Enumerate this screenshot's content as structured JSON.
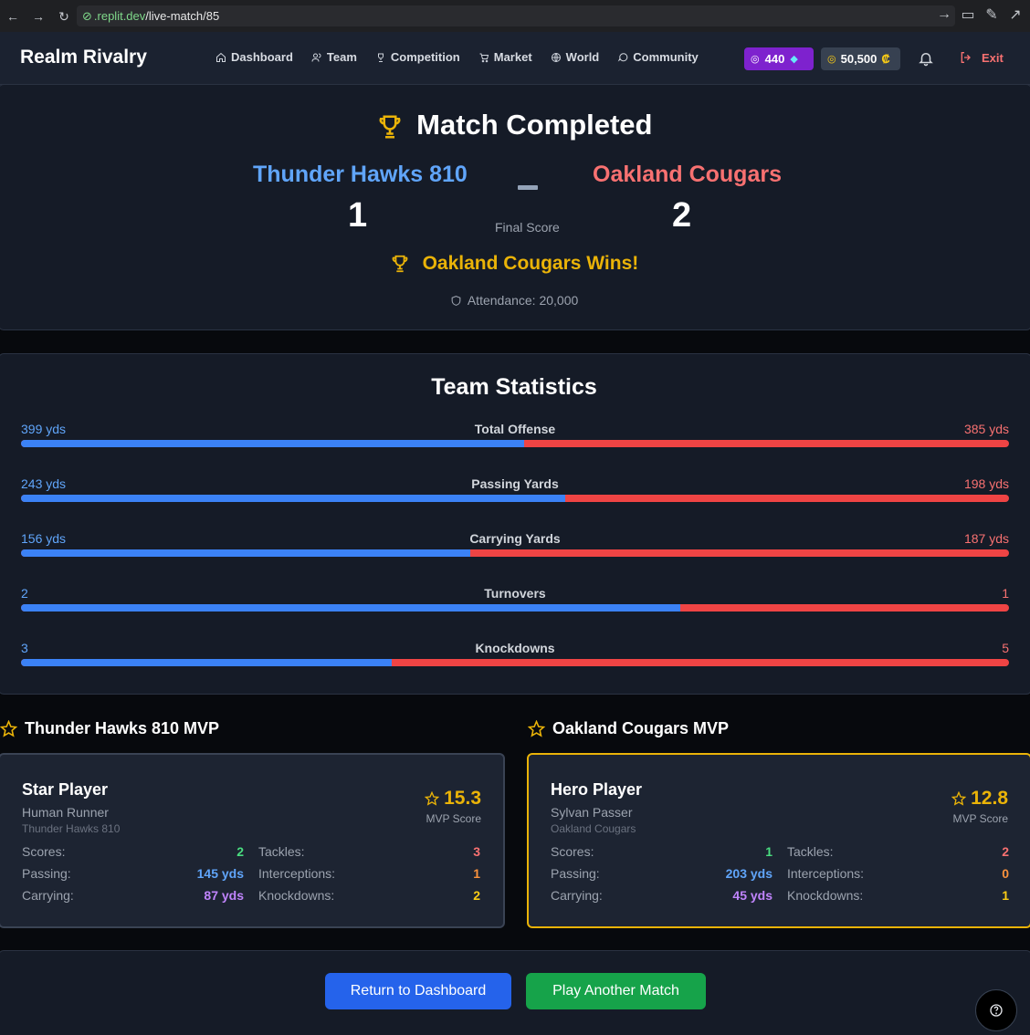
{
  "browser": {
    "url_host": ".replit.dev",
    "url_path": "/live-match/85"
  },
  "header": {
    "brand": "Realm Rivalry",
    "nav": [
      {
        "label": "Dashboard",
        "icon": "home-icon"
      },
      {
        "label": "Team",
        "icon": "users-icon"
      },
      {
        "label": "Competition",
        "icon": "trophy-icon"
      },
      {
        "label": "Market",
        "icon": "cart-icon"
      },
      {
        "label": "World",
        "icon": "globe-icon"
      },
      {
        "label": "Community",
        "icon": "chat-icon"
      }
    ],
    "gems": "440",
    "coins": "50,500",
    "coin_symbol": "₡",
    "exit_label": "Exit"
  },
  "match": {
    "title": "Match Completed",
    "home_team": "Thunder Hawks 810",
    "away_team": "Oakland Cougars",
    "home_score": "1",
    "away_score": "2",
    "final_label": "Final Score",
    "winner_text": "Oakland Cougars Wins!",
    "attendance": "Attendance: 20,000"
  },
  "stats": {
    "title": "Team Statistics",
    "rows": [
      {
        "label": "Total Offense",
        "home": "399 yds",
        "away": "385 yds",
        "home_share": 0.509
      },
      {
        "label": "Passing Yards",
        "home": "243 yds",
        "away": "198 yds",
        "home_share": 0.551
      },
      {
        "label": "Carrying Yards",
        "home": "156 yds",
        "away": "187 yds",
        "home_share": 0.455
      },
      {
        "label": "Turnovers",
        "home": "2",
        "away": "1",
        "home_share": 0.667
      },
      {
        "label": "Knockdowns",
        "home": "3",
        "away": "5",
        "home_share": 0.375
      }
    ]
  },
  "mvp": {
    "home": {
      "heading": "Thunder Hawks 810 MVP",
      "name": "Star Player",
      "role": "Human Runner",
      "team": "Thunder Hawks 810",
      "score": "15.3",
      "score_label": "MVP Score",
      "scores": "2",
      "passing": "145 yds",
      "carrying": "87 yds",
      "tackles": "3",
      "interceptions": "1",
      "knockdowns": "2"
    },
    "away": {
      "heading": "Oakland Cougars MVP",
      "name": "Hero Player",
      "role": "Sylvan Passer",
      "team": "Oakland Cougars",
      "score": "12.8",
      "score_label": "MVP Score",
      "scores": "1",
      "passing": "203 yds",
      "carrying": "45 yds",
      "tackles": "2",
      "interceptions": "0",
      "knockdowns": "1"
    },
    "labels": {
      "scores": "Scores:",
      "passing": "Passing:",
      "carrying": "Carrying:",
      "tackles": "Tackles:",
      "interceptions": "Interceptions:",
      "knockdowns": "Knockdowns:"
    }
  },
  "actions": {
    "return_label": "Return to Dashboard",
    "play_label": "Play Another Match"
  },
  "colors": {
    "home": "#60a5fa",
    "away": "#f87171",
    "accent": "#eab308",
    "home_bar": "#3b82f6",
    "away_bar": "#ef4444"
  }
}
